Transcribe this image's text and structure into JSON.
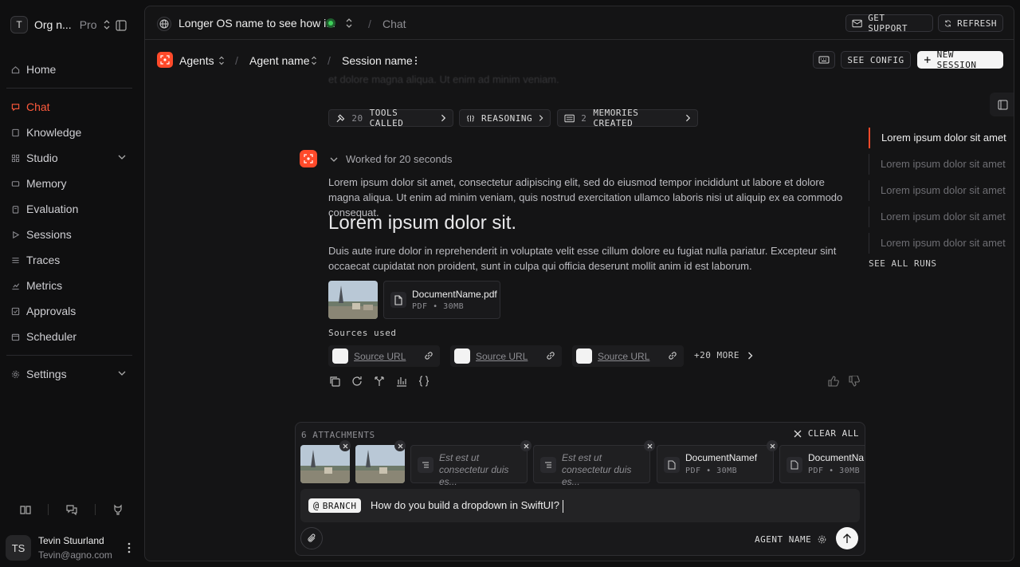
{
  "sidebar": {
    "org_initial": "T",
    "org_name": "Org n...",
    "org_plan": "Pro",
    "nav": [
      {
        "label": "Home",
        "icon": "home-icon"
      },
      {
        "label": "Chat",
        "icon": "chat-icon"
      },
      {
        "label": "Knowledge",
        "icon": "book-icon"
      },
      {
        "label": "Studio",
        "icon": "grid-icon"
      },
      {
        "label": "Memory",
        "icon": "memory-icon"
      },
      {
        "label": "Evaluation",
        "icon": "clipboard-icon"
      },
      {
        "label": "Sessions",
        "icon": "play-icon"
      },
      {
        "label": "Traces",
        "icon": "list-icon"
      },
      {
        "label": "Metrics",
        "icon": "chart-icon"
      },
      {
        "label": "Approvals",
        "icon": "check-square-icon"
      },
      {
        "label": "Scheduler",
        "icon": "calendar-icon"
      },
      {
        "label": "Settings",
        "icon": "gear-icon"
      }
    ],
    "active_item": "Chat",
    "user": {
      "initials": "TS",
      "name": "Tevin Stuurland",
      "email": "Tevin@agno.com"
    }
  },
  "topbar": {
    "os_name": "Longer OS name to see how i...",
    "os_status_color": "#3ecf5a",
    "crumb": "Chat",
    "get_support": "GET SUPPORT",
    "refresh": "REFRESH"
  },
  "subbar": {
    "agents": "Agents",
    "agent_name": "Agent name",
    "session_name": "Session name",
    "see_config": "SEE CONFIG",
    "new_session": "NEW SESSION"
  },
  "chat": {
    "faded_text": "et dolore magna aliqua. Ut enim ad minim veniam.",
    "chips": {
      "tools_count": "20",
      "tools_label": "TOOLS CALLED",
      "reasoning": "REASONING",
      "memories_count": "2",
      "memories_label": "MEMORIES CREATED"
    },
    "worked_for": "Worked for 20 seconds",
    "para1": "Lorem ipsum dolor sit amet, consectetur adipiscing elit, sed do eiusmod tempor incididunt ut labore et dolore magna aliqua. Ut enim ad minim veniam, quis nostrud exercitation ullamco laboris nisi ut aliquip ex ea commodo consequat.",
    "heading": "Lorem ipsum dolor sit.",
    "para2": "Duis aute irure dolor in reprehenderit in voluptate velit esse cillum dolore eu fugiat nulla pariatur. Excepteur sint occaecat cupidatat non proident, sunt in culpa qui officia deserunt mollit anim id est laborum.",
    "file": {
      "name": "DocumentName.pdf",
      "meta": "PDF • 30MB"
    },
    "sources_title": "Sources used",
    "sources": [
      "Source URL",
      "Source URL",
      "Source URL"
    ],
    "more_sources": "+20 MORE"
  },
  "runs": {
    "items": [
      "Lorem ipsum dolor sit amet",
      "Lorem ipsum dolor sit amet",
      "Lorem ipsum dolor sit amet",
      "Lorem ipsum dolor sit amet",
      "Lorem ipsum dolor sit amet"
    ],
    "see_all": "SEE ALL RUNS"
  },
  "composer": {
    "attachments_count": "6 ATTACHMENTS",
    "clear_all": "CLEAR ALL",
    "attachments": [
      {
        "kind": "image"
      },
      {
        "kind": "image"
      },
      {
        "kind": "text",
        "text": "Est est ut consectetur duis es..."
      },
      {
        "kind": "text",
        "text": "Est est ut consectetur duis es..."
      },
      {
        "kind": "file",
        "name": "DocumentNamef",
        "meta": "PDF • 30MB"
      },
      {
        "kind": "file",
        "name": "DocumentNa",
        "meta": "PDF • 30MB"
      }
    ],
    "branch_label": "BRANCH",
    "input_value": "How do you build a dropdown in SwiftUI?",
    "agent_selector": "AGENT NAME"
  },
  "colors": {
    "accent": "#ff4a2a",
    "bg": "#0f0f10",
    "panel": "#141415"
  }
}
